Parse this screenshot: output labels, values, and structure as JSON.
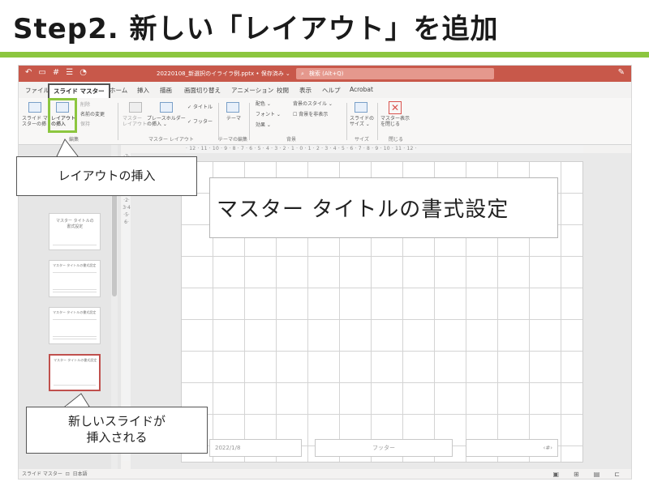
{
  "heading": {
    "title": "Step2. 新しい「レイアウト」を追加"
  },
  "colors": {
    "accent_green": "#8cc63f",
    "titlebar": "#c8584a",
    "selection_red": "#c0504d"
  },
  "app": {
    "quick_access_icons": [
      "undo-icon",
      "save-icon",
      "grid-icon",
      "layout-icon",
      "color-icon"
    ],
    "document_name": "20220108_新選択のイライラ例.pptx • 保存済み ⌄",
    "search_placeholder": "検索 (Alt+Q)",
    "tabs": [
      "ファイル",
      "スライド マスター",
      "ホーム",
      "挿入",
      "描画",
      "画面切り替え",
      "アニメーション",
      "校閲",
      "表示",
      "ヘルプ",
      "Acrobat"
    ],
    "active_tab": "スライド マスター",
    "ribbon": {
      "insert_master": "スライド マ\nスターの挿",
      "insert_layout": "レイアウト\nの挿入",
      "delete": "削除",
      "rename": "名前の変更",
      "preserve": "保持",
      "master_layout": "マスター\nレイアウト",
      "placeholder": "プレースホルダー\nの挿入 ⌄",
      "title_check": "タイトル",
      "footer_check": "フッター",
      "theme": "テーマ",
      "colors": "配色 ⌄",
      "fonts": "フォント ⌄",
      "effects": "効果 ⌄",
      "bg_style": "背景のスタイル ⌄",
      "hide_bg": "背景を非表示",
      "slide_size": "スライドの\nサイズ ⌄",
      "close_master": "マスター表示\nを閉じる",
      "group_edit": "編集",
      "group_master_layout": "マスター レイアウト",
      "group_theme_edit": "テーマの編集",
      "group_background": "背景",
      "group_size": "サイズ",
      "group_close": "閉じる"
    },
    "ruler_h": "· 12 · 11 · 10 · 9 · 8 · 7 · 6 · 5 · 4 · 3 · 2 · 1 · 0 · 1 · 2 · 3 · 4 · 5 · 6 · 7 · 8 · 9 · 10 · 11 · 12 ·",
    "ruler_v": "·7·6·5·4·3·2·1·0·1·2·3·4·5·6·",
    "thumbnails": [
      {
        "text": "マスター タイトルの\n書式設定",
        "selected": false
      },
      {
        "text": "マスター タイトルの書式設定",
        "selected": false
      },
      {
        "text": "マスター タイトルの書式設定",
        "selected": false
      },
      {
        "text": "マスター タイトルの書式設定",
        "selected": true
      }
    ],
    "slide": {
      "title_placeholder": "マスター タイトルの書式設定",
      "date": "2022/1/8",
      "footer": "フッター",
      "page_number": "‹#›"
    },
    "status": {
      "mode": "スライド マスター",
      "language": "日本語"
    }
  },
  "callouts": {
    "insert_layout": "レイアウトの挿入",
    "new_slide_line1": "新しいスライドが",
    "new_slide_line2": "挿入される"
  }
}
